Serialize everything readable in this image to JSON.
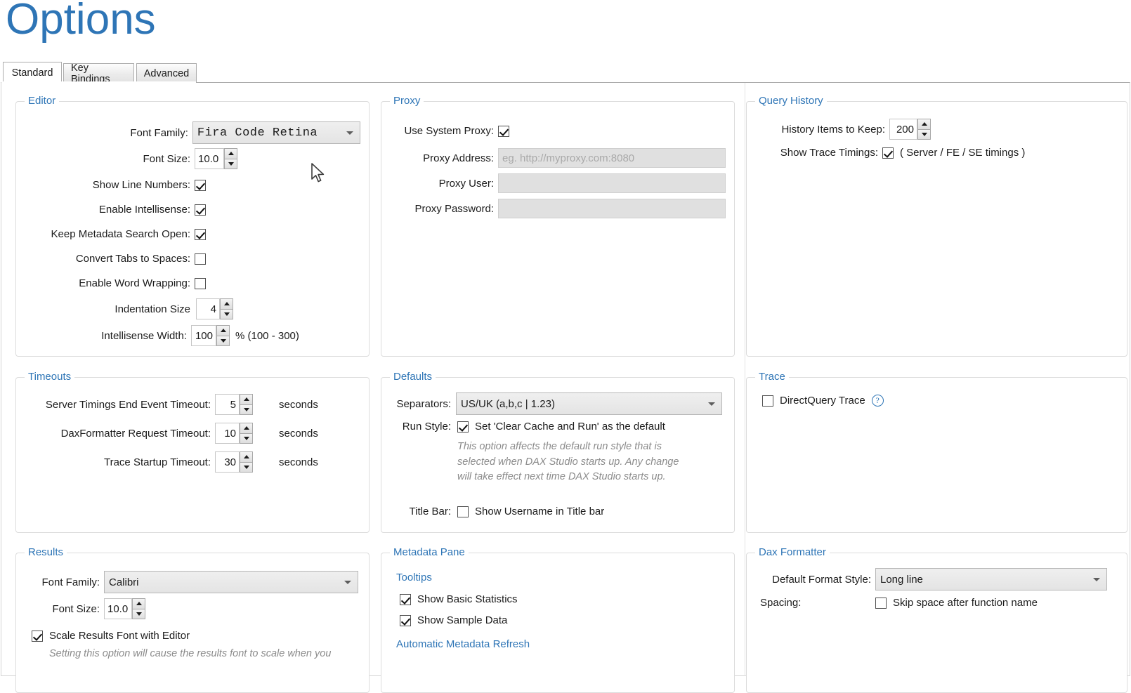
{
  "page": {
    "title": "Options"
  },
  "tabs": [
    {
      "label": "Standard",
      "active": true
    },
    {
      "label": "Key Bindings",
      "active": false
    },
    {
      "label": "Advanced",
      "active": false
    }
  ],
  "colors": {
    "accent": "#2e75b6",
    "group_border": "#dcdcdc",
    "text": "#1b1b1b",
    "muted": "#8b8b8b"
  },
  "groups": {
    "editor": {
      "title": "Editor",
      "font_family_label": "Font Family:",
      "font_family_value": "Fira Code Retina",
      "font_size_label": "Font Size:",
      "font_size_value": "10.0",
      "show_line_numbers_label": "Show Line Numbers:",
      "enable_intellisense_label": "Enable Intellisense:",
      "keep_metadata_search_open_label": "Keep Metadata Search Open:",
      "convert_tabs_label": "Convert Tabs to Spaces:",
      "word_wrap_label": "Enable Word Wrapping:",
      "indentation_label": "Indentation Size",
      "indentation_value": "4",
      "intellisense_width_label": "Intellisense Width:",
      "intellisense_width_value": "100",
      "intellisense_width_suffix": "% (100 - 300)"
    },
    "proxy": {
      "title": "Proxy",
      "use_system_proxy_label": "Use System Proxy:",
      "address_label": "Proxy Address:",
      "address_placeholder": "eg. http://myproxy.com:8080",
      "user_label": "Proxy User:",
      "user_value": "",
      "password_label": "Proxy Password:",
      "password_value": ""
    },
    "query_history": {
      "title": "Query History",
      "items_to_keep_label": "History Items to Keep:",
      "items_to_keep_value": "200",
      "show_trace_timings_label": "Show Trace Timings:",
      "show_trace_timings_suffix": "( Server / FE / SE timings )"
    },
    "timeouts": {
      "title": "Timeouts",
      "server_timings_label": "Server Timings End Event Timeout:",
      "server_timings_value": "5",
      "daxformatter_label": "DaxFormatter Request Timeout:",
      "daxformatter_value": "10",
      "trace_startup_label": "Trace Startup Timeout:",
      "trace_startup_value": "30",
      "units": "seconds"
    },
    "defaults": {
      "title": "Defaults",
      "separators_label": "Separators:",
      "separators_value": "US/UK (a,b,c | 1.23)",
      "run_style_label": "Run Style:",
      "run_style_checkbox_label": "Set 'Clear Cache and Run' as the default",
      "run_style_hint": "This option affects the default run style that is selected when DAX Studio starts up. Any change will take effect next time DAX Studio starts up.",
      "title_bar_label": "Title Bar:",
      "title_bar_checkbox_label": "Show Username in Title bar"
    },
    "trace": {
      "title": "Trace",
      "directquery_label": "DirectQuery Trace",
      "help_glyph": "?"
    },
    "results": {
      "title": "Results",
      "font_family_label": "Font Family:",
      "font_family_value": "Calibri",
      "font_size_label": "Font Size:",
      "font_size_value": "10.0",
      "scale_label": "Scale Results Font with Editor",
      "scale_hint": "Setting this option will cause the results font to scale when you"
    },
    "metadata_pane": {
      "title": "Metadata Pane",
      "tooltips_heading": "Tooltips",
      "basic_stats_label": "Show Basic Statistics",
      "sample_data_label": "Show Sample Data",
      "auto_refresh_heading": "Automatic Metadata Refresh"
    },
    "dax_formatter": {
      "title": "Dax Formatter",
      "format_style_label": "Default Format Style:",
      "format_style_value": "Long line",
      "spacing_label": "Spacing:",
      "skip_space_label": "Skip space after function name"
    }
  },
  "icons": {
    "chevron_down": "chevron-down-icon",
    "spinner_up": "spinner-up-icon",
    "spinner_down": "spinner-down-icon",
    "mouse_cursor": "mouse-pointer-icon"
  }
}
